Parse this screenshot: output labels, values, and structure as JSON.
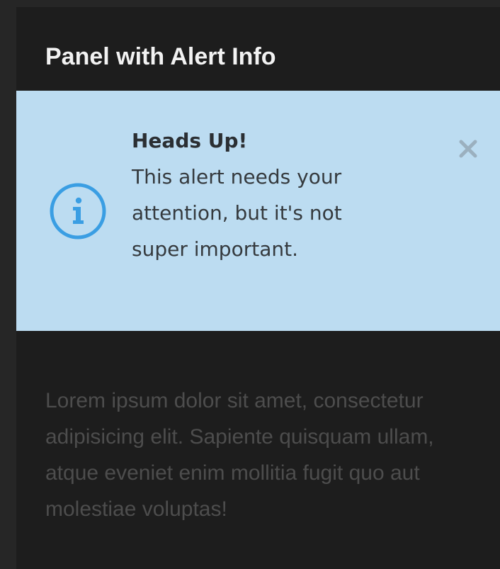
{
  "panel": {
    "title": "Panel with Alert Info",
    "body_text": "Lorem ipsum dolor sit amet, consectetur adipisicing elit. Sapiente quisquam ullam, atque eveniet enim mollitia fugit quo aut molestiae voluptas!"
  },
  "alert": {
    "heading": "Heads Up!",
    "message": "This alert needs your attention, but it's not super important.",
    "icon": "info-circle-icon",
    "close_icon": "close-icon",
    "colors": {
      "background": "#bcdcf1",
      "icon": "#3a9ee3",
      "text": "#353a3e"
    }
  },
  "colors": {
    "page_background": "#262626",
    "panel_background": "#1d1d1d",
    "title_text": "#f2f2f2",
    "body_text": "#4d4d4d"
  }
}
